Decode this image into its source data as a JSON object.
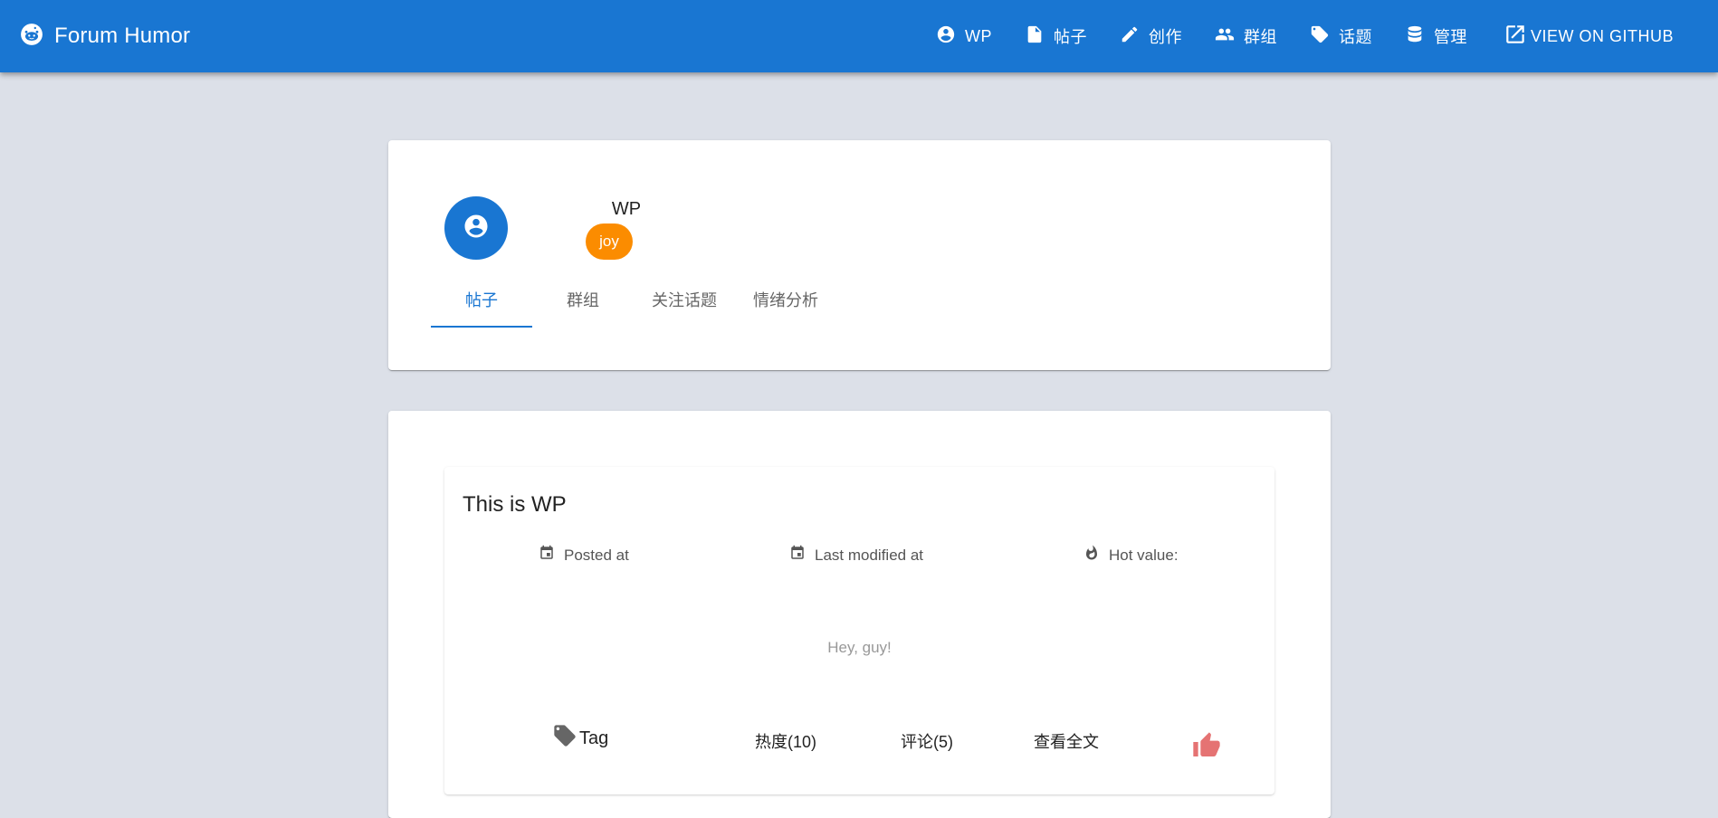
{
  "app": {
    "title": "Forum Humor"
  },
  "nav": {
    "items": [
      {
        "label": "WP",
        "icon": "account-circle-icon"
      },
      {
        "label": "帖子",
        "icon": "file-icon"
      },
      {
        "label": "创作",
        "icon": "pencil-icon"
      },
      {
        "label": "群组",
        "icon": "group-icon"
      },
      {
        "label": "话题",
        "icon": "tag-icon"
      },
      {
        "label": "管理",
        "icon": "database-icon"
      }
    ],
    "github": {
      "label": "VIEW ON GITHUB",
      "icon": "open-in-new-icon"
    }
  },
  "profile": {
    "name": "WP",
    "mood": "joy",
    "tabs": [
      {
        "label": "帖子",
        "active": true
      },
      {
        "label": "群组"
      },
      {
        "label": "关注话题"
      },
      {
        "label": "情绪分析"
      }
    ]
  },
  "post": {
    "title": "This is WP",
    "posted_at_label": "Posted at",
    "modified_label": "Last modified at",
    "hot_label": "Hot value:",
    "body": "Hey, guy!",
    "tag_label": "Tag",
    "heat": "热度(10)",
    "comments": "评论(5)",
    "read_more": "查看全文"
  },
  "colors": {
    "primary": "#1976d2",
    "background": "#dce0e8",
    "mood_chip": "#fb8c00",
    "like": "#e57373"
  }
}
